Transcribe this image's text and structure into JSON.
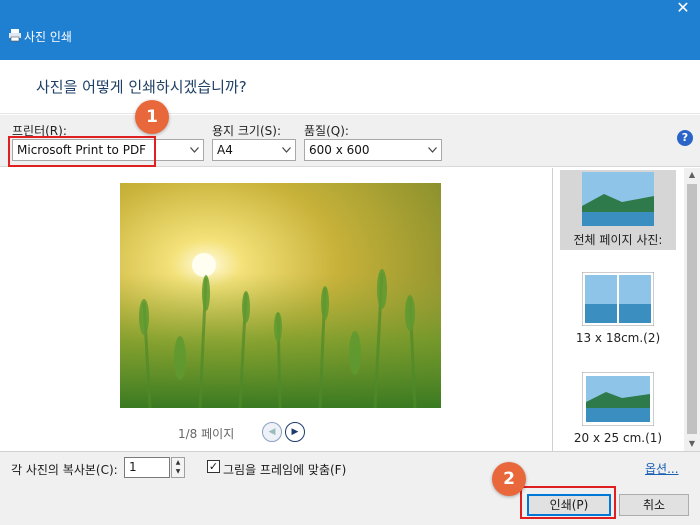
{
  "window": {
    "title": "사진 인쇄",
    "close_glyph": "✕"
  },
  "header": {
    "question": "사진을 어떻게 인쇄하시겠습니까?"
  },
  "options": {
    "printer_label": "프린터(R):",
    "printer_value": "Microsoft Print to PDF",
    "paper_label": "용지 크기(S):",
    "paper_value": "A4",
    "quality_label": "품질(Q):",
    "quality_value": "600 x 600",
    "help_glyph": "?"
  },
  "preview": {
    "page_indicator": "1/8 페이지",
    "prev_glyph": "◀",
    "next_glyph": "▶"
  },
  "layouts": [
    {
      "label": "전체 페이지 사진:",
      "selected": true
    },
    {
      "label": "13 x 18cm.(2)",
      "selected": false
    },
    {
      "label": "20 x 25 cm.(1)",
      "selected": false
    }
  ],
  "footer": {
    "copies_label": "각 사진의 복사본(C):",
    "copies_value": "1",
    "fit_checked": true,
    "fit_label": "그림을 프레임에 맞춤(F)",
    "options_link": "옵션...",
    "print_button": "인쇄(P)",
    "cancel_button": "취소"
  },
  "annotations": {
    "badge_1": "1",
    "badge_2": "2",
    "badge_color": "#e8683c",
    "highlight_color": "#e02020"
  },
  "colors": {
    "titlebar": "#1f7fd0",
    "accent": "#0078d7"
  }
}
